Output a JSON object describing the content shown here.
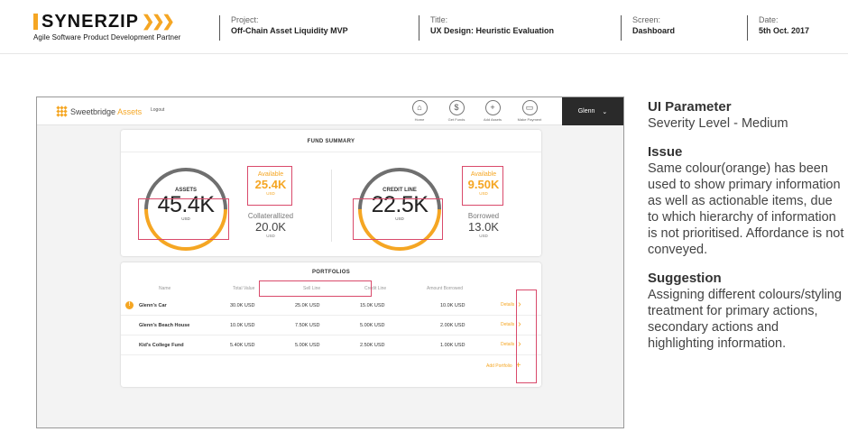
{
  "header": {
    "logo_word": "SYNERZIP",
    "logo_tagline": "Agile Software Product Development Partner",
    "project_label": "Project:",
    "project_value": "Off-Chain Asset Liquidity MVP",
    "title_label": "Title:",
    "title_value": "UX Design: Heuristic Evaluation",
    "screen_label": "Screen:",
    "screen_value": "Dashboard",
    "date_label": "Date:",
    "date_value": "5th Oct. 2017"
  },
  "app": {
    "brand_first": "Sweetbridge",
    "brand_second": "Assets",
    "logout": "Logout",
    "nav": [
      {
        "label": "Home",
        "icon": "home-icon",
        "glyph": "⌂"
      },
      {
        "label": "Get Funds",
        "icon": "dollar-icon",
        "glyph": "$"
      },
      {
        "label": "Add Assets",
        "icon": "plus-icon",
        "glyph": "+"
      },
      {
        "label": "Make Payment",
        "icon": "payment-icon",
        "glyph": "▭"
      }
    ],
    "user_name": "Glenn",
    "user_chevron": "⌄",
    "fund_summary": {
      "title": "FUND SUMMARY",
      "assets": {
        "label": "ASSETS",
        "value": "45.4K",
        "unit": "USD"
      },
      "assets_available": {
        "label": "Available",
        "value": "25.4K",
        "unit": "USD"
      },
      "collateralized": {
        "label": "Collaterallized",
        "value": "20.0K",
        "unit": "USD"
      },
      "credit_line": {
        "label": "CREDIT LINE",
        "value": "22.5K",
        "unit": "USD"
      },
      "credit_available": {
        "label": "Available",
        "value": "9.50K",
        "unit": "USD"
      },
      "borrowed": {
        "label": "Borrowed",
        "value": "13.0K",
        "unit": "USD"
      }
    },
    "portfolios": {
      "title": "PORTFOLIOS",
      "columns": [
        "Name",
        "Total Value",
        "Sell Line",
        "Credit Line",
        "Amount Borrowed"
      ],
      "rows": [
        {
          "name": "Glenn's Car",
          "total": "30.0K USD",
          "sell": "25.0K USD",
          "credit": "15.0K USD",
          "borrowed": "10.0K USD",
          "action": "Details",
          "warning": "!"
        },
        {
          "name": "Glenn's Beach House",
          "total": "10.0K USD",
          "sell": "7.50K USD",
          "credit": "5.00K USD",
          "borrowed": "2.00K USD",
          "action": "Details"
        },
        {
          "name": "Kid's College Fund",
          "total": "5.40K USD",
          "sell": "5.00K USD",
          "credit": "2.50K USD",
          "borrowed": "1.00K USD",
          "action": "Details"
        }
      ],
      "add_label": "Add Portfolio"
    }
  },
  "notes": {
    "ui_parameter_heading": "UI Parameter",
    "severity": "Severity Level - Medium",
    "issue_heading": "Issue",
    "issue_text": "Same colour(orange) has been used to show primary information as well as actionable items, due to which hierarchy of information is not prioritised. Affordance is not conveyed.",
    "suggestion_heading": "Suggestion",
    "suggestion_text": "Assigning different colours/styling treatment for primary actions, secondary actions and highlighting information."
  },
  "colors": {
    "accent": "#f5a623",
    "highlight": "#d94a6b",
    "dark": "#2a2a2a"
  }
}
